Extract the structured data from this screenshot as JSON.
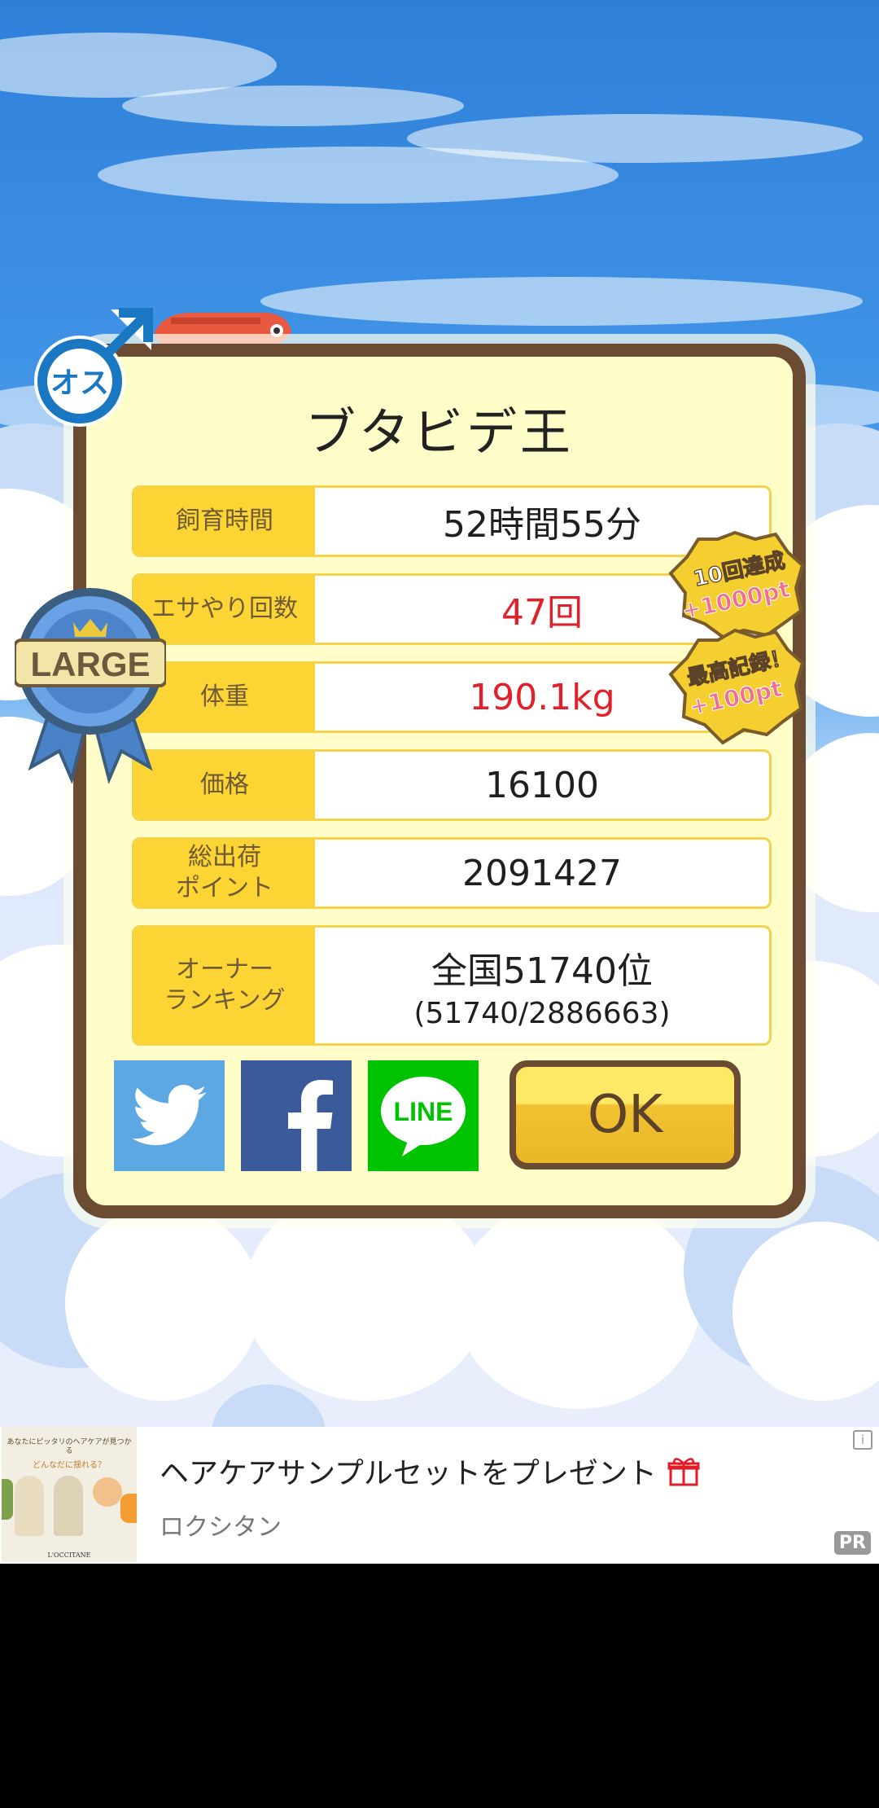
{
  "title": "ブタビデ王",
  "stats": [
    {
      "label": "飼育時間",
      "value": "52時間55分",
      "highlight": false
    },
    {
      "label": "エサやり回数",
      "value": "47回",
      "highlight": true
    },
    {
      "label": "体重",
      "value": "190.1kg",
      "highlight": true
    },
    {
      "label": "価格",
      "value": "16100",
      "highlight": false
    },
    {
      "label": "総出荷\nポイント",
      "value": "2091427",
      "highlight": false
    },
    {
      "label": "オーナー\nランキング",
      "value": "全国51740位",
      "sub": "(51740/2886663)",
      "highlight": false
    }
  ],
  "gender_badge": {
    "text": "オス",
    "icon": "male-symbol-icon"
  },
  "size_badge": {
    "text": "LARGE",
    "icon": "ribbon-icon"
  },
  "bonus_badges": [
    {
      "line1": "10回達成",
      "line2": "+1000pt"
    },
    {
      "line1": "最高記録！",
      "line2": "+100pt"
    }
  ],
  "share": {
    "twitter_icon": "twitter-bird-icon",
    "facebook_icon": "facebook-f-icon",
    "line_label": "LINE"
  },
  "ok_label": "OK",
  "ad": {
    "title": "ヘアケアサンプルセットをプレゼント",
    "advertiser": "ロクシタン",
    "pr_label": "PR",
    "info_label": "i",
    "gift_icon": "gift-icon",
    "img_headline": "あなたにピッタリのヘアケアが見つかる",
    "img_question": "どんなだに揺れる？",
    "img_brand": "L'OCCITANE"
  },
  "colors": {
    "panel_border": "#6b4b32",
    "panel_bg": "#fffdc8",
    "label_bg": "#fcd434",
    "highlight_value": "#e0202a",
    "twitter": "#5da7e2",
    "facebook": "#3b5a9a",
    "line": "#00c300"
  }
}
